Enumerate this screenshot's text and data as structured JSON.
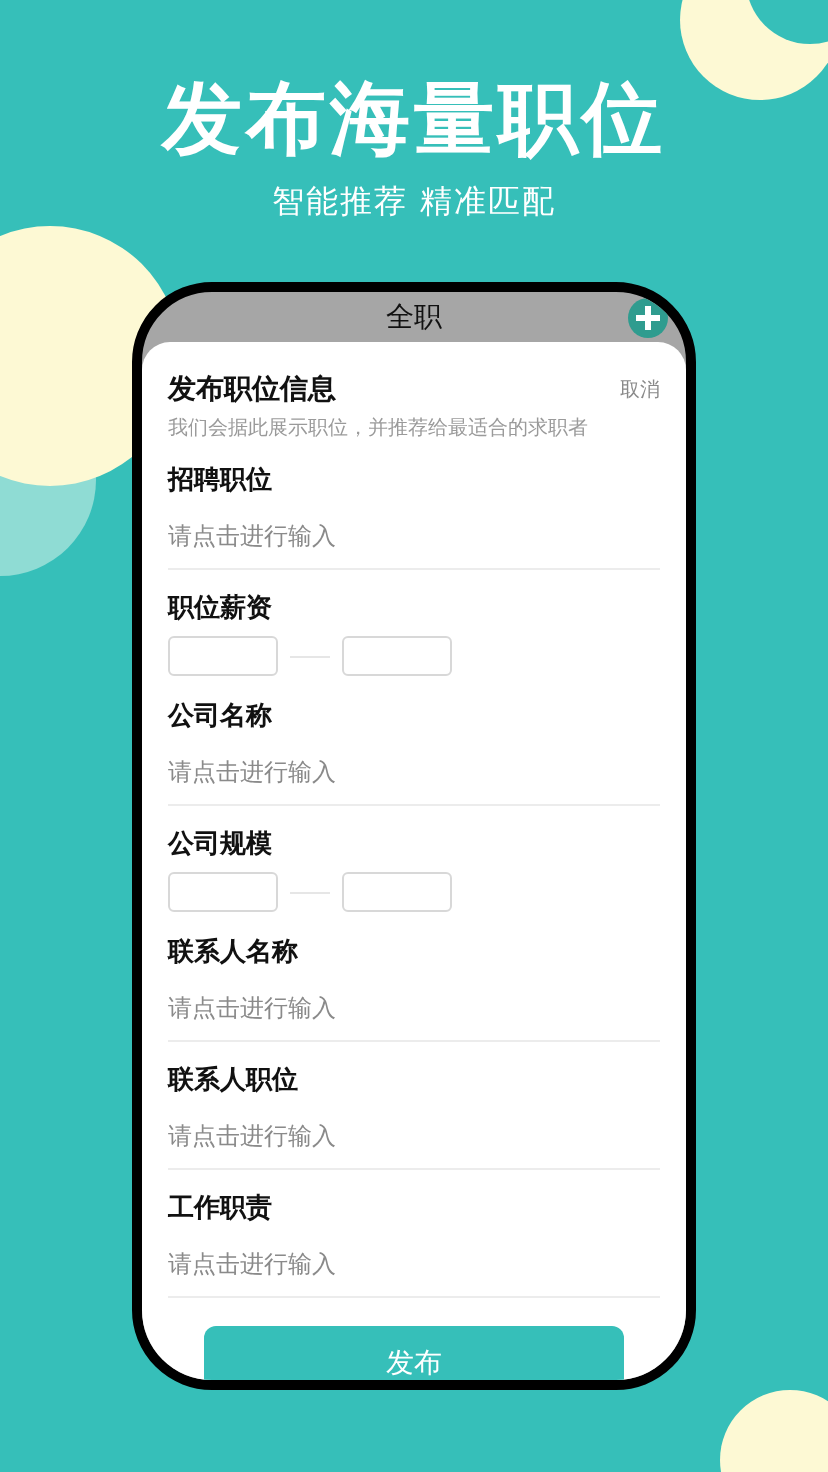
{
  "headline": "发布海量职位",
  "subtitle": "智能推荐 精准匹配",
  "screen": {
    "header_title": "全职",
    "form_title": "发布职位信息",
    "cancel": "取消",
    "hint": "我们会据此展示职位，并推荐给最适合的求职者",
    "fields": [
      {
        "kind": "text",
        "label": "招聘职位",
        "placeholder": "请点击进行输入"
      },
      {
        "kind": "range",
        "label": "职位薪资"
      },
      {
        "kind": "text",
        "label": "公司名称",
        "placeholder": "请点击进行输入"
      },
      {
        "kind": "range",
        "label": "公司规模"
      },
      {
        "kind": "text",
        "label": "联系人名称",
        "placeholder": "请点击进行输入"
      },
      {
        "kind": "text",
        "label": "联系人职位",
        "placeholder": "请点击进行输入"
      },
      {
        "kind": "text",
        "label": "工作职责",
        "placeholder": "请点击进行输入"
      }
    ],
    "submit": "发布"
  }
}
